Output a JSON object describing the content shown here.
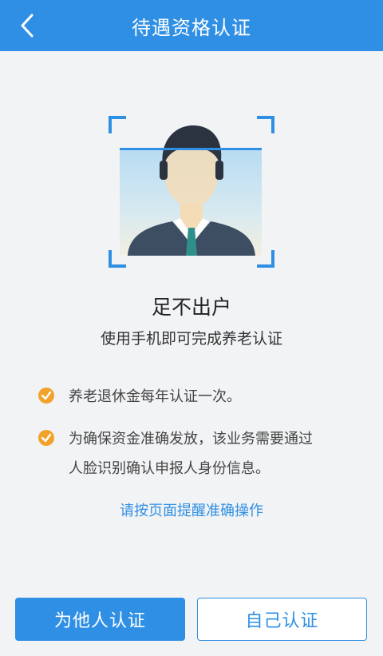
{
  "header": {
    "title": "待遇资格认证",
    "back_icon": "back-arrow-icon"
  },
  "main": {
    "title": "足不出户",
    "subtitle": "使用手机即可完成养老认证",
    "notes": [
      {
        "icon": "check-circle-icon",
        "text": "养老退休金每年认证一次。"
      },
      {
        "icon": "check-circle-icon",
        "text_line1": "为确保资金准确发放，该业务需要通过",
        "text_line2": "人脸识别确认申报人身份信息。"
      }
    ],
    "hint": "请按页面提醒准确操作"
  },
  "buttons": {
    "others": "为他人认证",
    "self": "自己认证"
  },
  "colors": {
    "brand": "#2f8fe4",
    "check": "#f2a22b"
  }
}
